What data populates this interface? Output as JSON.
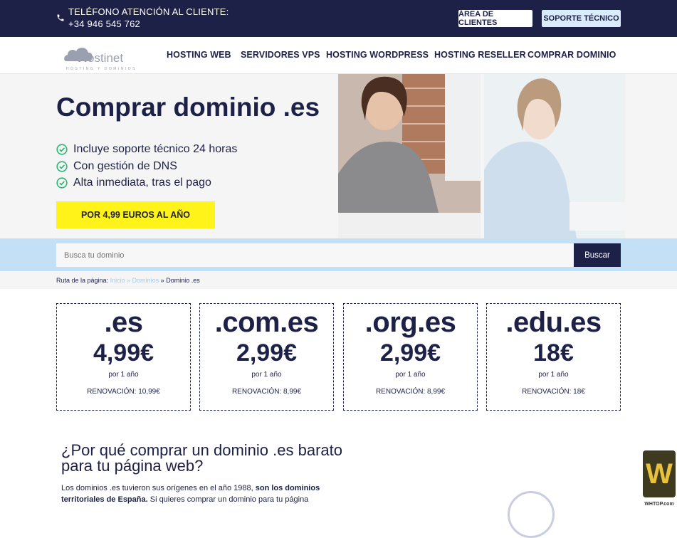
{
  "topbar": {
    "phone_line1": "TELÉFONO ATENCIÓN AL CLIENTE:",
    "phone_line2": "+34 946 545 762",
    "area_clientes": "ÁREA DE CLIENTES",
    "soporte_tecnico": "SOPORTE TÉCNICO"
  },
  "logo": {
    "name": "Hostinet",
    "tagline": "hosting y dominios"
  },
  "nav": [
    "HOSTING WEB",
    "SERVIDORES VPS",
    "HOSTING WORDPRESS",
    "HOSTING RESELLER",
    "COMPRAR DOMINIO"
  ],
  "hero": {
    "title": "Comprar dominio .es",
    "features": [
      "Incluye soporte técnico 24 horas",
      "Con gestión de DNS",
      "Alta inmediata, tras el pago"
    ],
    "cta": "POR 4,99 EUROS AL AÑO"
  },
  "search": {
    "placeholder": "Busca tu dominio",
    "button": "Buscar"
  },
  "breadcrumb": {
    "prefix": "Ruta de la página:",
    "items": [
      "Inicio",
      "Dominios",
      "Dominio .es"
    ],
    "separator": "»"
  },
  "pricing": [
    {
      "tld": ".es",
      "price": "4,99€",
      "period": "por 1 año",
      "renewal": "RENOVACIÓN: 10,99€"
    },
    {
      "tld": ".com.es",
      "price": "2,99€",
      "period": "por 1 año",
      "renewal": "RENOVACIÓN: 8,99€"
    },
    {
      "tld": ".org.es",
      "price": "2,99€",
      "period": "por 1 año",
      "renewal": "RENOVACIÓN: 8,99€"
    },
    {
      "tld": ".edu.es",
      "price": "18€",
      "period": "por 1 año",
      "renewal": "RENOVACIÓN: 18€"
    }
  ],
  "why": {
    "title": "¿Por qué comprar un dominio .es barato para tu página web?",
    "text_start": "Los dominios .es tuvieron sus orígenes en el año 1988, ",
    "text_bold": "son los dominios territoriales de España.",
    "text_end": " Si quieres comprar un dominio para tu página"
  },
  "watermark": {
    "label": "WHTOP.com"
  },
  "colors": {
    "navy": "#1d2147",
    "yellow": "#fff319",
    "light_blue": "#c3e0f7",
    "green_check": "#2bb673"
  },
  "icons": {
    "phone": "phone-icon",
    "check": "check-circle-icon"
  }
}
